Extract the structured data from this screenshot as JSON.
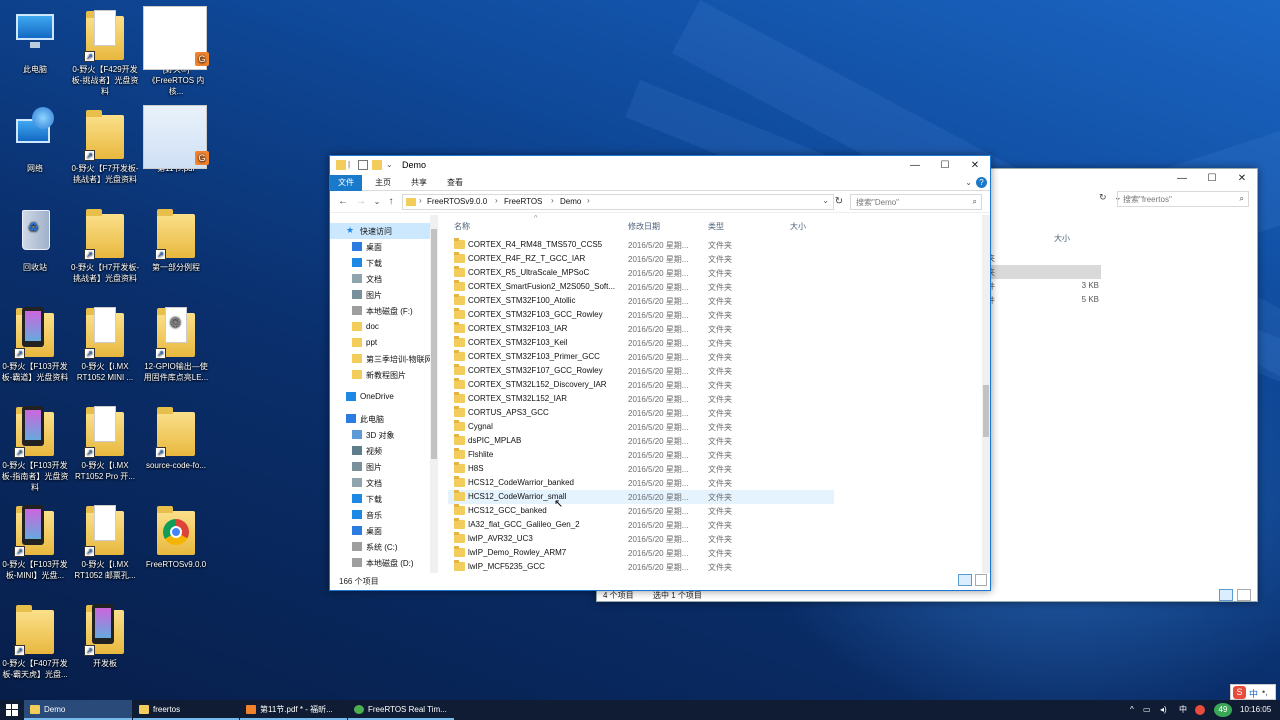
{
  "desktop": {
    "icons": [
      {
        "label": "此电脑",
        "kind": "pc"
      },
      {
        "label": "0-野火【F429开发板-挑战者】光盘资料",
        "kind": "folder-doc"
      },
      {
        "label": "[野火®]《FreeRTOS 内核...",
        "kind": "pdf"
      },
      {
        "label": "网络",
        "kind": "network"
      },
      {
        "label": "0-野火【F7开发板-挑战者】光盘资料",
        "kind": "folder"
      },
      {
        "label": "第11节.pdf",
        "kind": "pdf-slide"
      },
      {
        "label": "回收站",
        "kind": "recycle"
      },
      {
        "label": "0-野火【H7开发板-挑战者】光盘资料",
        "kind": "folder"
      },
      {
        "label": "第一部分例程",
        "kind": "folder"
      },
      {
        "label": "0-野火【F103开发板-霸道】光盘资料",
        "kind": "folder-phone"
      },
      {
        "label": "0-野火【i.MX RT1052 MINI ...",
        "kind": "folder-doc"
      },
      {
        "label": "12-GPIO输出—使用固件库点亮LE...",
        "kind": "folder-gear"
      },
      {
        "label": "0-野火【F103开发板-指南者】光盘资料",
        "kind": "folder-phone"
      },
      {
        "label": "0-野火【i.MX RT1052 Pro 开...",
        "kind": "folder-doc"
      },
      {
        "label": "source-code-fo...",
        "kind": "folder"
      },
      {
        "label": "0-野火【F103开发板-MINI】光盘...",
        "kind": "folder-phone"
      },
      {
        "label": "0-野火【i.MX RT1052 邮票孔...",
        "kind": "folder-doc"
      },
      {
        "label": "FreeRTOSv9.0.0",
        "kind": "chrome"
      },
      {
        "label": "0-野火【F407开发板-霸天虎】光盘...",
        "kind": "folder"
      },
      {
        "label": "开发板",
        "kind": "folder-phone"
      }
    ]
  },
  "back_window": {
    "search_placeholder": "搜索\"freertos\"",
    "col_size": "大小",
    "rows": [
      {
        "type_partial": "夹",
        "size": ""
      },
      {
        "type_partial": "夹",
        "size": ""
      },
      {
        "type_partial": "件",
        "size": "3 KB"
      },
      {
        "type_partial": "件",
        "size": "5 KB"
      }
    ],
    "status_count": "4 个项目",
    "status_selected": "选中 1 个项目"
  },
  "main_window": {
    "title": "Demo",
    "tabs": [
      "文件",
      "主页",
      "共享",
      "查看"
    ],
    "breadcrumb": [
      "FreeRTOSv9.0.0",
      "FreeRTOS",
      "Demo"
    ],
    "search_placeholder": "搜索\"Demo\"",
    "nav": [
      {
        "label": "快速访问",
        "icon": "star-icon",
        "level": 0,
        "pin": false,
        "selected": true
      },
      {
        "label": "桌面",
        "icon": "desktop-icon",
        "level": 1,
        "pin": true
      },
      {
        "label": "下载",
        "icon": "download-icon",
        "level": 1,
        "pin": true
      },
      {
        "label": "文档",
        "icon": "documents-icon",
        "level": 1,
        "pin": true
      },
      {
        "label": "图片",
        "icon": "pictures-icon",
        "level": 1,
        "pin": true
      },
      {
        "label": "本地磁盘 (F:)",
        "icon": "drive-icon",
        "level": 1,
        "pin": true
      },
      {
        "label": "doc",
        "icon": "folder-icon",
        "level": 1,
        "pin": false
      },
      {
        "label": "ppt",
        "icon": "folder-icon",
        "level": 1,
        "pin": false
      },
      {
        "label": "第三季培训-物联网",
        "icon": "folder-icon",
        "level": 1,
        "pin": false
      },
      {
        "label": "新教程图片",
        "icon": "folder-icon",
        "level": 1,
        "pin": false
      },
      {
        "label": "OneDrive",
        "icon": "cloud-icon",
        "level": 0,
        "pin": false
      },
      {
        "label": "此电脑",
        "icon": "pc-icon",
        "level": 0,
        "pin": false
      },
      {
        "label": "3D 对象",
        "icon": "3d-icon",
        "level": 1,
        "pin": false
      },
      {
        "label": "视频",
        "icon": "video-icon",
        "level": 1,
        "pin": false
      },
      {
        "label": "图片",
        "icon": "pictures-icon",
        "level": 1,
        "pin": false
      },
      {
        "label": "文档",
        "icon": "documents-icon",
        "level": 1,
        "pin": false
      },
      {
        "label": "下载",
        "icon": "download-icon",
        "level": 1,
        "pin": false
      },
      {
        "label": "音乐",
        "icon": "music-icon",
        "level": 1,
        "pin": false
      },
      {
        "label": "桌面",
        "icon": "desktop-icon",
        "level": 1,
        "pin": false
      },
      {
        "label": "系统 (C:)",
        "icon": "drive-icon",
        "level": 1,
        "pin": false
      },
      {
        "label": "本地磁盘 (D:)",
        "icon": "drive-icon",
        "level": 1,
        "pin": false
      }
    ],
    "columns": {
      "name": "名称",
      "date": "修改日期",
      "type": "类型",
      "size": "大小"
    },
    "files": [
      {
        "name": "CORTEX_R4_RM48_TMS570_CCS5",
        "date": "2016/5/20 星期...",
        "type": "文件夹"
      },
      {
        "name": "CORTEX_R4F_RZ_T_GCC_IAR",
        "date": "2016/5/20 星期...",
        "type": "文件夹"
      },
      {
        "name": "CORTEX_R5_UltraScale_MPSoC",
        "date": "2016/5/20 星期...",
        "type": "文件夹"
      },
      {
        "name": "CORTEX_SmartFusion2_M2S050_Soft...",
        "date": "2016/5/20 星期...",
        "type": "文件夹"
      },
      {
        "name": "CORTEX_STM32F100_Atollic",
        "date": "2016/5/20 星期...",
        "type": "文件夹"
      },
      {
        "name": "CORTEX_STM32F103_GCC_Rowley",
        "date": "2016/5/20 星期...",
        "type": "文件夹"
      },
      {
        "name": "CORTEX_STM32F103_IAR",
        "date": "2016/5/20 星期...",
        "type": "文件夹"
      },
      {
        "name": "CORTEX_STM32F103_Keil",
        "date": "2016/5/20 星期...",
        "type": "文件夹"
      },
      {
        "name": "CORTEX_STM32F103_Primer_GCC",
        "date": "2016/5/20 星期...",
        "type": "文件夹"
      },
      {
        "name": "CORTEX_STM32F107_GCC_Rowley",
        "date": "2016/5/20 星期...",
        "type": "文件夹"
      },
      {
        "name": "CORTEX_STM32L152_Discovery_IAR",
        "date": "2016/5/20 星期...",
        "type": "文件夹"
      },
      {
        "name": "CORTEX_STM32L152_IAR",
        "date": "2016/5/20 星期...",
        "type": "文件夹"
      },
      {
        "name": "CORTUS_APS3_GCC",
        "date": "2016/5/20 星期...",
        "type": "文件夹"
      },
      {
        "name": "Cygnal",
        "date": "2016/5/20 星期...",
        "type": "文件夹"
      },
      {
        "name": "dsPIC_MPLAB",
        "date": "2016/5/20 星期...",
        "type": "文件夹"
      },
      {
        "name": "Flshlite",
        "date": "2016/5/20 星期...",
        "type": "文件夹"
      },
      {
        "name": "H8S",
        "date": "2016/5/20 星期...",
        "type": "文件夹"
      },
      {
        "name": "HCS12_CodeWarrior_banked",
        "date": "2016/5/20 星期...",
        "type": "文件夹"
      },
      {
        "name": "HCS12_CodeWarrior_small",
        "date": "2016/5/20 星期...",
        "type": "文件夹",
        "hover": true
      },
      {
        "name": "HCS12_GCC_banked",
        "date": "2016/5/20 星期...",
        "type": "文件夹"
      },
      {
        "name": "IA32_flat_GCC_Galileo_Gen_2",
        "date": "2016/5/20 星期...",
        "type": "文件夹"
      },
      {
        "name": "lwIP_AVR32_UC3",
        "date": "2016/5/20 星期...",
        "type": "文件夹"
      },
      {
        "name": "lwIP_Demo_Rowley_ARM7",
        "date": "2016/5/20 星期...",
        "type": "文件夹"
      },
      {
        "name": "lwIP_MCF5235_GCC",
        "date": "2016/5/20 星期...",
        "type": "文件夹"
      }
    ],
    "status_count": "166 个项目"
  },
  "taskbar": {
    "items": [
      {
        "label": "Demo",
        "icon_color": "#f2cd5c",
        "state": "active"
      },
      {
        "label": "freertos",
        "icon_color": "#f2cd5c",
        "state": "open"
      },
      {
        "label": "第11节.pdf * - 福昕...",
        "icon_color": "#f0822e",
        "state": "open"
      },
      {
        "label": "FreeRTOS Real Tim...",
        "icon_color": "#4caf50",
        "state": "open"
      }
    ],
    "tray": {
      "ime": "中",
      "badge": "49",
      "time": "10:16:05"
    },
    "overlay_logo_text": "中"
  }
}
